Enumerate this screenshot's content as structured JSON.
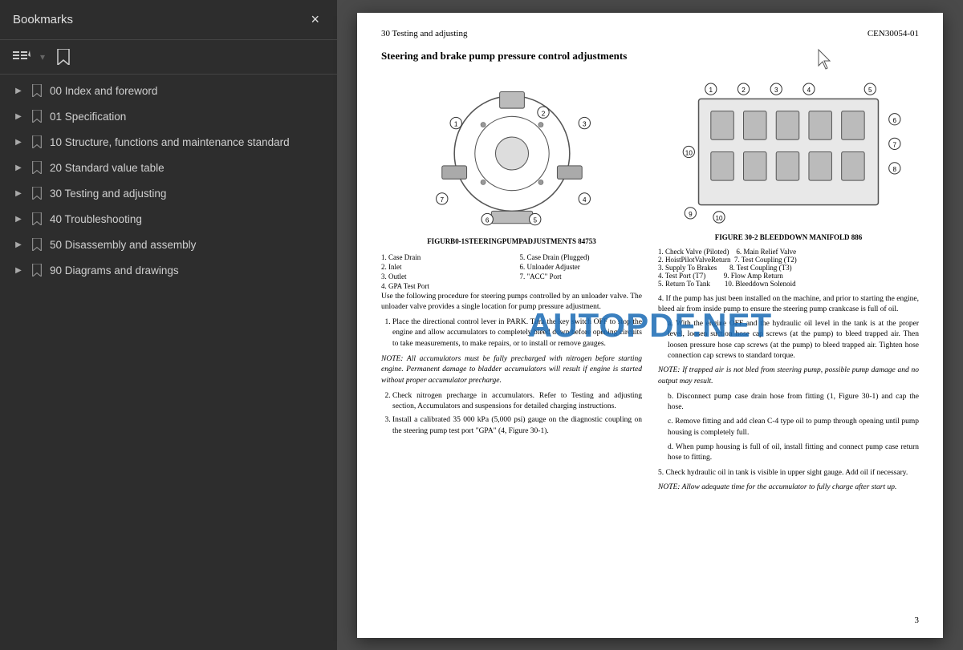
{
  "sidebar": {
    "title": "Bookmarks",
    "close_label": "×",
    "items": [
      {
        "id": "item-00",
        "label": "00 Index and foreword",
        "expanded": false
      },
      {
        "id": "item-01",
        "label": "01 Specification",
        "expanded": false
      },
      {
        "id": "item-10",
        "label": "10 Structure, functions and maintenance standard",
        "expanded": false
      },
      {
        "id": "item-20",
        "label": "20 Standard value table",
        "expanded": false
      },
      {
        "id": "item-30",
        "label": "30 Testing and adjusting",
        "expanded": false
      },
      {
        "id": "item-40",
        "label": "40 Troubleshooting",
        "expanded": false
      },
      {
        "id": "item-50",
        "label": "50 Disassembly and assembly",
        "expanded": false
      },
      {
        "id": "item-90",
        "label": "90 Diagrams and drawings",
        "expanded": false
      }
    ]
  },
  "page": {
    "header_left": "30 Testing and adjusting",
    "header_right": "CEN30054-01",
    "section_title": "Steering and brake pump pressure control adjustments",
    "figure_left_label": "FIGURB0-1STEERINGPUMPADJUSTMENTS 84753",
    "figure_left_parts": [
      "1. Case Drain       5. Case Drain (Plugged)",
      "2. Inlet            6. Unloader Adjuster",
      "3. Outlet           7. \"ACC\" Port",
      "4. GPA Test Port"
    ],
    "figure_right_label": "FIGURE 30-2  BLEEDDOWN MANIFOLD 886",
    "figure_right_parts_col1": [
      "1. Check Valve (Piloted)   6. Main Relief Valve",
      "2. HoistPilotValveReturn  7. Test Coupling (T2)",
      "3. Supply To Brakes        8. Test Coupling (T3)",
      "4. Test Port (T7)          9. Flow Amp Return",
      "5. Return To Tank         10. Bleeddown Solenoid"
    ],
    "main_text": "Use the following procedure for steering pumps controlled by an unloader valve. The unloader valve provides a single location for pump pressure adjustment.",
    "steps": [
      "Place the directional control lever in PARK. Turn the key switch OFF to stop the engine and allow accumulators to completely bleed down before opening circuits to take measurements, to make repairs, or to install or remove gauges.",
      "Check nitrogen precharge in accumulators. Refer to Testing and adjusting section, Accumulators and suspensions for detailed charging instructions.",
      "Install a calibrated 35 000 kPa (5,000 psi) gauge on the diagnostic coupling on the steering pump test port \"GPA\" (4, Figure 30-1)."
    ],
    "note1": "NOTE: All accumulators must be fully precharged with nitrogen before starting engine. Permanent damage to bladder accumulators will result if engine is started without proper accumulator precharge.",
    "right_step4_text": "4. If the pump has just been installed on the machine, and prior to starting the engine, bleed air from inside pump to ensure the steering pump crankcase is full of oil.",
    "right_step_a": "a. With the engine OFF and the hydraulic oil level in the tank is at the proper level, loosen suction hose cap screws (at the pump) to bleed trapped air. Then loosen pressure hose cap screws (at the pump) to bleed trapped air. Tighten hose connection cap screws to standard torque.",
    "note2": "NOTE: If trapped air is not bled from steering pump, possible pump damage and no output may result.",
    "right_step_b": "b. Disconnect pump case drain hose from fitting (1, Figure 30-1) and cap the hose.",
    "right_step_c": "c. Remove fitting and add clean C-4 type oil to pump through opening until pump housing is completely full.",
    "right_step_d": "d. When pump housing is full of oil, install fitting and connect pump case return hose to fitting.",
    "right_step5": "5. Check hydraulic oil in tank is visible in upper sight gauge. Add oil if necessary.",
    "note3": "NOTE: Allow adequate time for the accumulator to fully charge after start up.",
    "page_number": "3",
    "watermark": "AUTOPDF.NET"
  }
}
